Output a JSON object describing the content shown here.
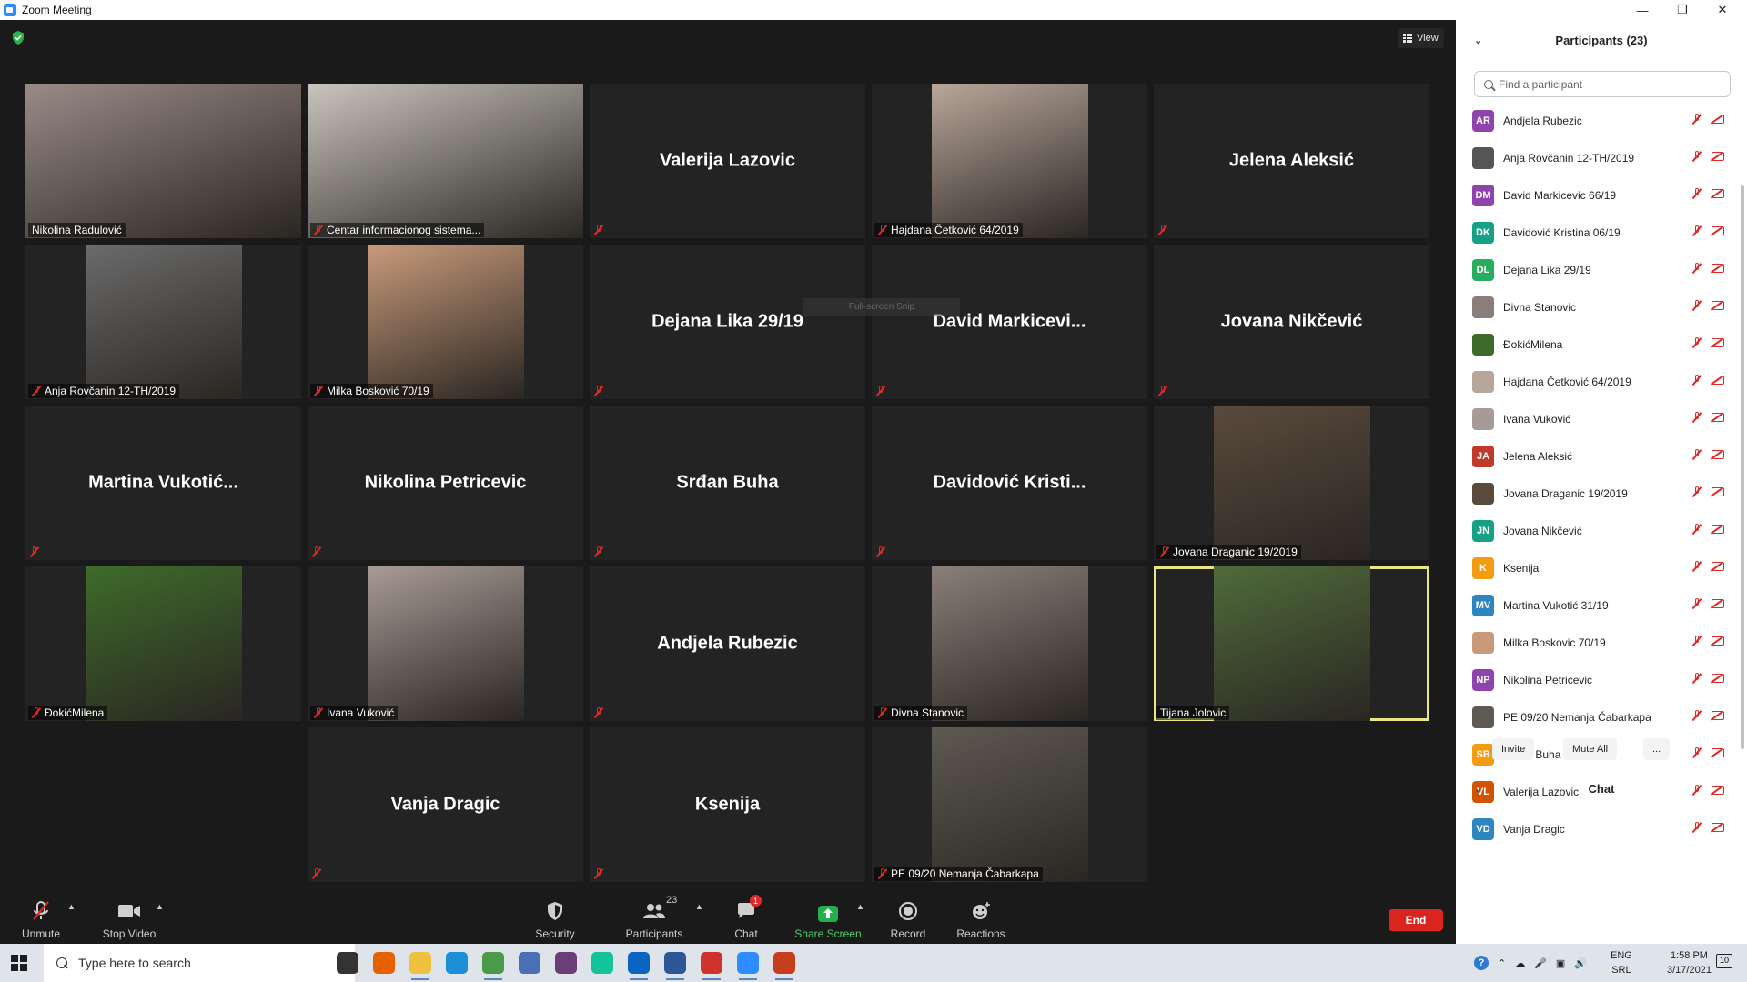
{
  "window": {
    "title": "Zoom Meeting"
  },
  "meeting": {
    "view_label": "View",
    "fullscreen_tooltip": "Full-screen Snip",
    "tiles": [
      {
        "name": "Nikolina Radulović",
        "label": "Nikolina Radulović",
        "video": true,
        "muted": false,
        "bg": "#9a8a86"
      },
      {
        "name": "Centar informacionog sistema...",
        "label": "Centar informacionog sistema...",
        "video": true,
        "muted": true,
        "bg": "#c9c4bd"
      },
      {
        "name": "Valerija Lazovic",
        "video": false,
        "muted": true
      },
      {
        "name": "Hajdana Četković 64/2019",
        "label": "Hajdana Četković 64/2019",
        "video": true,
        "muted": true,
        "bg": "#b8a69a"
      },
      {
        "name": "Jelena Aleksić",
        "video": false,
        "muted": true
      },
      {
        "name": "Anja Rovčanin 12-TH/2019",
        "label": "Anja Rovčanin 12-TH/2019",
        "video": true,
        "muted": true,
        "bg": "#6b6b6b"
      },
      {
        "name": "Milka Bosković 70/19",
        "label": "Milka Bosković 70/19",
        "video": true,
        "muted": true,
        "bg": "#c89a7a"
      },
      {
        "name": "Dejana Lika 29/19",
        "video": false,
        "muted": true
      },
      {
        "name": "David  Markicevi...",
        "video": false,
        "muted": true
      },
      {
        "name": "Jovana Nikčević",
        "video": false,
        "muted": true
      },
      {
        "name": "Martina  Vukotić...",
        "video": false,
        "muted": true
      },
      {
        "name": "Nikolina Petricevic",
        "video": false,
        "muted": true
      },
      {
        "name": "Srđan Buha",
        "video": false,
        "muted": true
      },
      {
        "name": "Davidović  Kristi...",
        "video": false,
        "muted": true
      },
      {
        "name": "Jovana Draganic 19/2019",
        "label": "Jovana Draganic 19/2019",
        "video": true,
        "muted": true,
        "bg": "#5a4a3c"
      },
      {
        "name": "ĐokićMilena",
        "label": "ĐokićMilena",
        "video": true,
        "muted": true,
        "bg": "#3e6b2a"
      },
      {
        "name": "Ivana Vuković",
        "label": "Ivana Vuković",
        "video": true,
        "muted": true,
        "bg": "#a89a94"
      },
      {
        "name": "Andjela Rubezic",
        "video": false,
        "muted": true
      },
      {
        "name": "Divna Stanovic",
        "label": "Divna Stanovic",
        "video": true,
        "muted": true,
        "bg": "#8a7f78"
      },
      {
        "name": "Tijana Jolovic",
        "label": "Tijana Jolovic",
        "video": true,
        "muted": false,
        "active": true,
        "bg": "#4f6b3a"
      },
      {
        "name": "Vanja Dragic",
        "video": false,
        "muted": true
      },
      {
        "name": "Ksenija",
        "video": false,
        "muted": true
      },
      {
        "name": "PE 09/20 Nemanja Čabarkapa",
        "label": "PE 09/20 Nemanja Čabarkapa",
        "video": true,
        "muted": true,
        "bg": "#5e5a52"
      }
    ]
  },
  "toolbar": {
    "unmute": "Unmute",
    "stop_video": "Stop Video",
    "security": "Security",
    "participants": "Participants",
    "participants_count": "23",
    "chat": "Chat",
    "chat_badge": "1",
    "share_screen": "Share Screen",
    "record": "Record",
    "reactions": "Reactions",
    "end": "End"
  },
  "panel": {
    "title": "Participants (23)",
    "search_placeholder": "Find a participant",
    "participants": [
      {
        "initials": "AR",
        "name": "Andjela Rubezic",
        "color": "#8e44ad"
      },
      {
        "initials": "",
        "name": "Anja Rovčanin 12-TH/2019",
        "color": "#555555"
      },
      {
        "initials": "DM",
        "name": "David Markicevic 66/19",
        "color": "#8e44ad"
      },
      {
        "initials": "DK",
        "name": "Davidović Kristina 06/19",
        "color": "#16a085"
      },
      {
        "initials": "DL",
        "name": "Dejana Lika 29/19",
        "color": "#27ae60"
      },
      {
        "initials": "",
        "name": "Divna Stanovic",
        "color": "#8a7f78"
      },
      {
        "initials": "",
        "name": "ĐokićMilena",
        "color": "#3e6b2a"
      },
      {
        "initials": "",
        "name": "Hajdana Četković 64/2019",
        "color": "#b8a69a"
      },
      {
        "initials": "",
        "name": "Ivana Vuković",
        "color": "#a89a94"
      },
      {
        "initials": "JA",
        "name": "Jelena Aleksić",
        "color": "#c0392b"
      },
      {
        "initials": "",
        "name": "Jovana Draganic 19/2019",
        "color": "#5a4a3c"
      },
      {
        "initials": "JN",
        "name": "Jovana Nikčević",
        "color": "#16a085"
      },
      {
        "initials": "K",
        "name": "Ksenija",
        "color": "#f39c12"
      },
      {
        "initials": "MV",
        "name": "Martina Vukotić 31/19",
        "color": "#2e86c1"
      },
      {
        "initials": "",
        "name": "Milka Boskovic 70/19",
        "color": "#c89a7a"
      },
      {
        "initials": "NP",
        "name": "Nikolina Petricevic",
        "color": "#8e44ad"
      },
      {
        "initials": "",
        "name": "PE 09/20 Nemanja Čabarkapa",
        "color": "#5e5a52"
      },
      {
        "initials": "SB",
        "name": "Srđan Buha",
        "color": "#f39c12"
      },
      {
        "initials": "VL",
        "name": "Valerija Lazovic",
        "color": "#d35400"
      },
      {
        "initials": "VD",
        "name": "Vanja Dragic",
        "color": "#2e86c1"
      }
    ],
    "invite": "Invite",
    "mute_all": "Mute All",
    "more": "...",
    "chat_title": "Chat"
  },
  "taskbar": {
    "search_text": "Type here to search",
    "lang_line1": "ENG",
    "lang_line2": "SRL",
    "time": "1:58 PM",
    "date": "3/17/2021",
    "notifications": "10",
    "apps": [
      {
        "name": "task-view",
        "color": "#333333"
      },
      {
        "name": "firefox",
        "color": "#e66000"
      },
      {
        "name": "file-explorer",
        "color": "#f0c040"
      },
      {
        "name": "edge",
        "color": "#1a8fd6"
      },
      {
        "name": "chrome",
        "color": "#4a9a4a"
      },
      {
        "name": "app-blue",
        "color": "#4a6fb5"
      },
      {
        "name": "slack",
        "color": "#6b3e7a"
      },
      {
        "name": "grammarly",
        "color": "#15c39a"
      },
      {
        "name": "outlook",
        "color": "#0a64c4"
      },
      {
        "name": "word",
        "color": "#2b579a"
      },
      {
        "name": "app-red",
        "color": "#d0332b"
      },
      {
        "name": "zoom",
        "color": "#2d8cff"
      },
      {
        "name": "powerpoint",
        "color": "#c43e1c"
      }
    ]
  }
}
